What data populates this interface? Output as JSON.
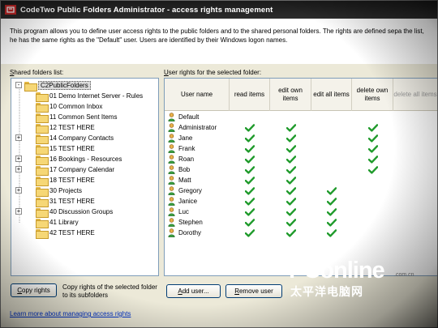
{
  "window": {
    "title": "CodeTwo Public Folders Administrator - access rights management"
  },
  "intro": {
    "text": "This program allows you to define user access rights to the public folders and to the shared personal folders. The rights are defined sepa the list, he has the same rights as the \"Default\" user. Users are identified by their Windows logon names."
  },
  "shared_folders": {
    "label_underlined": "S",
    "label_rest": "hared folders list:",
    "items": [
      {
        "label": "C2PublicFolders",
        "selected": true,
        "expander": "-"
      },
      {
        "label": "01 Demo Internet Server - Rules",
        "expander": ""
      },
      {
        "label": "10 Common Inbox",
        "expander": ""
      },
      {
        "label": "11 Common Sent Items",
        "expander": ""
      },
      {
        "label": "12 TEST HERE",
        "expander": ""
      },
      {
        "label": "14 Company Contacts",
        "expander": "+"
      },
      {
        "label": "15 TEST HERE",
        "expander": ""
      },
      {
        "label": "16 Bookings - Resources",
        "expander": "+"
      },
      {
        "label": "17 Company Calendar",
        "expander": "+"
      },
      {
        "label": "18 TEST HERE",
        "expander": ""
      },
      {
        "label": "30 Projects",
        "expander": "+"
      },
      {
        "label": "31 TEST HERE",
        "expander": ""
      },
      {
        "label": "40 Discussion Groups",
        "expander": "+"
      },
      {
        "label": "41 Library",
        "expander": ""
      },
      {
        "label": "42 TEST HERE",
        "expander": ""
      }
    ]
  },
  "user_rights": {
    "label_underlined": "U",
    "label_rest": "ser rights for the selected folder:",
    "columns": [
      {
        "label": "User name"
      },
      {
        "label": "read items"
      },
      {
        "label": "edit own items"
      },
      {
        "label": "edit all items"
      },
      {
        "label": "delete own items"
      },
      {
        "label": "delete all items"
      }
    ],
    "rows": [
      {
        "user": "Default",
        "rights": [
          false,
          false,
          false,
          false
        ]
      },
      {
        "user": "Administrator",
        "rights": [
          true,
          true,
          false,
          true
        ]
      },
      {
        "user": "Jane",
        "rights": [
          true,
          true,
          false,
          true
        ]
      },
      {
        "user": "Frank",
        "rights": [
          true,
          true,
          false,
          true
        ]
      },
      {
        "user": "Roan",
        "rights": [
          true,
          true,
          false,
          true
        ]
      },
      {
        "user": "Bob",
        "rights": [
          true,
          true,
          false,
          true
        ]
      },
      {
        "user": "Matt",
        "rights": [
          true,
          true,
          false,
          false
        ]
      },
      {
        "user": "Gregory",
        "rights": [
          true,
          true,
          true,
          false
        ]
      },
      {
        "user": "Janice",
        "rights": [
          true,
          true,
          true,
          false
        ]
      },
      {
        "user": "Luc",
        "rights": [
          true,
          true,
          true,
          false
        ]
      },
      {
        "user": "Stephen",
        "rights": [
          true,
          true,
          true,
          false
        ]
      },
      {
        "user": "Dorothy",
        "rights": [
          true,
          true,
          true,
          false
        ]
      }
    ]
  },
  "buttons": {
    "copy_rights_u": "C",
    "copy_rights_rest": "opy rights",
    "add_user_u": "A",
    "add_user_rest": "dd user...",
    "remove_user_u": "R",
    "remove_user_rest": "emove user"
  },
  "copy_description": "Copy rights of the selected folder to its subfolders",
  "learn_link": "Learn more about managing access rights",
  "watermark": {
    "brand": "PConline",
    "domain": ".com.cn",
    "chinese": "太平洋电脑网"
  },
  "colors": {
    "check": "#1e9a2a",
    "titlebar": "#1f1f1f",
    "link": "#0033cc"
  }
}
